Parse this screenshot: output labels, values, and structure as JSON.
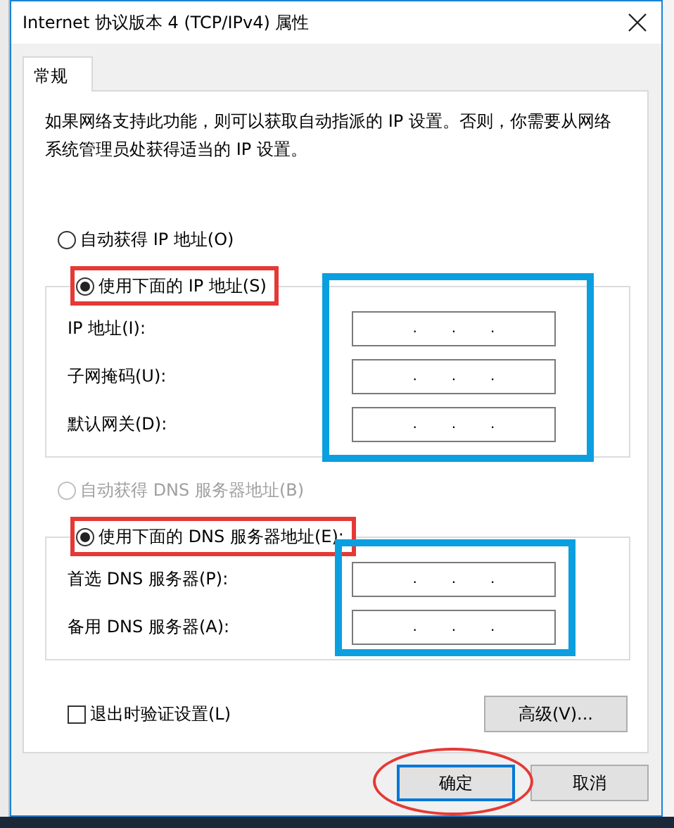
{
  "window": {
    "title": "Internet 协议版本 4 (TCP/IPv4) 属性"
  },
  "tabs": [
    {
      "label": "常规",
      "selected": true
    }
  ],
  "description": "如果网络支持此功能，则可以获取自动指派的 IP 设置。否则，你需要从网络系统管理员处获得适当的 IP 设置。",
  "ip_section": {
    "options": [
      {
        "label": "自动获得 IP 地址(O)",
        "selected": false,
        "disabled": false
      },
      {
        "label": "使用下面的 IP 地址(S)",
        "selected": true,
        "disabled": false
      }
    ],
    "fields": [
      {
        "label": "IP 地址(I):",
        "separators": [
          ".",
          ".",
          "."
        ]
      },
      {
        "label": "子网掩码(U):",
        "separators": [
          ".",
          ".",
          "."
        ]
      },
      {
        "label": "默认网关(D):",
        "separators": [
          ".",
          ".",
          "."
        ]
      }
    ]
  },
  "dns_section": {
    "options": [
      {
        "label": "自动获得 DNS 服务器地址(B)",
        "selected": false,
        "disabled": true
      },
      {
        "label": "使用下面的 DNS 服务器地址(E):",
        "selected": true,
        "disabled": false
      }
    ],
    "fields": [
      {
        "label": "首选 DNS 服务器(P):",
        "separators": [
          ".",
          ".",
          "."
        ]
      },
      {
        "label": "备用 DNS 服务器(A):",
        "separators": [
          ".",
          ".",
          "."
        ]
      }
    ]
  },
  "validate_on_exit": {
    "label": "退出时验证设置(L)",
    "checked": false
  },
  "advanced_button": "高级(V)...",
  "buttons": [
    {
      "label": "确定",
      "focused": true
    },
    {
      "label": "取消",
      "focused": false
    }
  ]
}
